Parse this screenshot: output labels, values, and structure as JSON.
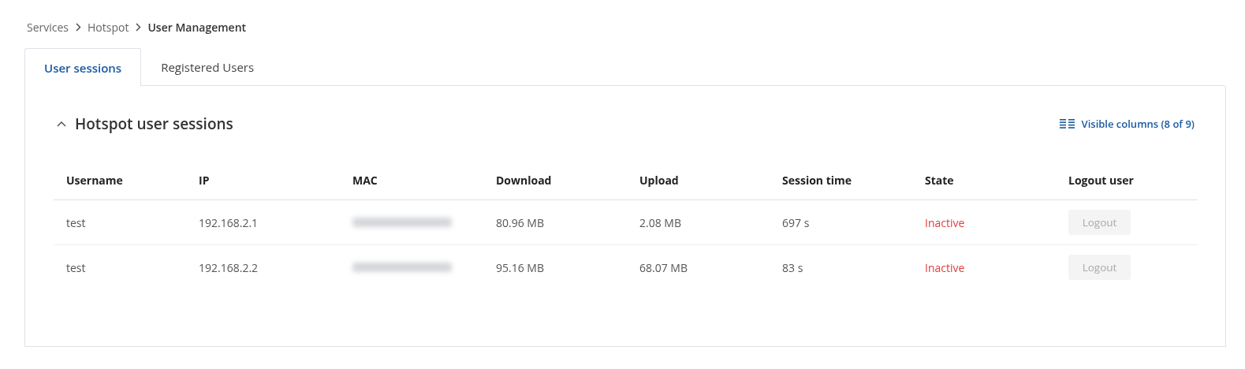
{
  "breadcrumb": [
    {
      "label": "Services",
      "current": false
    },
    {
      "label": "Hotspot",
      "current": false
    },
    {
      "label": "User Management",
      "current": true
    }
  ],
  "tabs": [
    {
      "label": "User sessions",
      "selected": true
    },
    {
      "label": "Registered Users",
      "selected": false
    }
  ],
  "section": {
    "title": "Hotspot user sessions",
    "expanded": true,
    "columns_link": "Visible columns (8 of 9)"
  },
  "table": {
    "columns": [
      "Username",
      "IP",
      "MAC",
      "Download",
      "Upload",
      "Session time",
      "State",
      "Logout user"
    ],
    "rows": [
      {
        "username": "test",
        "ip": "192.168.2.1",
        "mac_redacted": true,
        "download": "80.96 MB",
        "upload": "2.08 MB",
        "session_time": "697 s",
        "state": "Inactive",
        "active": false,
        "logout": {
          "label": "Logout",
          "disabled": true
        }
      },
      {
        "username": "test",
        "ip": "192.168.2.2",
        "mac_redacted": true,
        "download": "95.16 MB",
        "upload": "68.07 MB",
        "session_time": "83 s",
        "state": "Inactive",
        "active": false,
        "logout": {
          "label": "Logout",
          "disabled": true
        }
      }
    ]
  }
}
